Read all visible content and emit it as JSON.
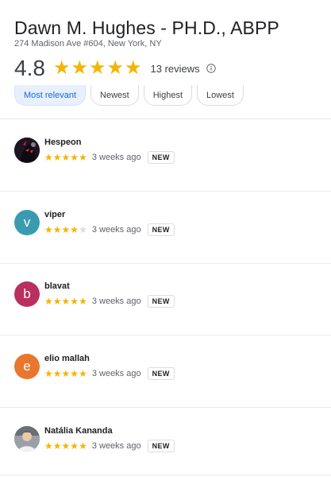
{
  "place": {
    "name": "Dawn M. Hughes - PH.D., ABPP",
    "address": "274 Madison Ave #604, New York, NY"
  },
  "summary": {
    "rating": "4.8",
    "stars": 5,
    "reviews_label": "13 reviews"
  },
  "filters": [
    {
      "label": "Most relevant",
      "selected": true
    },
    {
      "label": "Newest",
      "selected": false
    },
    {
      "label": "Highest",
      "selected": false
    },
    {
      "label": "Lowest",
      "selected": false
    }
  ],
  "colors": {
    "star": "#f4b400",
    "chip_selected_bg": "#e8f0fe",
    "chip_selected_text": "#1967d2"
  },
  "reviews": [
    {
      "author": "Hespeon",
      "rating": 5,
      "time": "3 weeks ago",
      "badge": "NEW",
      "avatar": {
        "type": "photo",
        "icon": "dark-character-avatar",
        "color": "#2b1b2e"
      }
    },
    {
      "author": "viper",
      "rating": 4,
      "time": "3 weeks ago",
      "badge": "NEW",
      "avatar": {
        "type": "letter",
        "letter": "v",
        "color": "#3a9bb0"
      }
    },
    {
      "author": "blavat",
      "rating": 5,
      "time": "3 weeks ago",
      "badge": "NEW",
      "avatar": {
        "type": "letter",
        "letter": "b",
        "color": "#b8305e"
      }
    },
    {
      "author": "elio mallah",
      "rating": 5,
      "time": "3 weeks ago",
      "badge": "NEW",
      "avatar": {
        "type": "letter",
        "letter": "e",
        "color": "#e8762c"
      }
    },
    {
      "author": "Natália Kananda",
      "rating": 5,
      "time": "3 weeks ago",
      "badge": "NEW",
      "avatar": {
        "type": "photo",
        "icon": "person-photo-avatar",
        "color": "#8a8f96"
      }
    }
  ]
}
